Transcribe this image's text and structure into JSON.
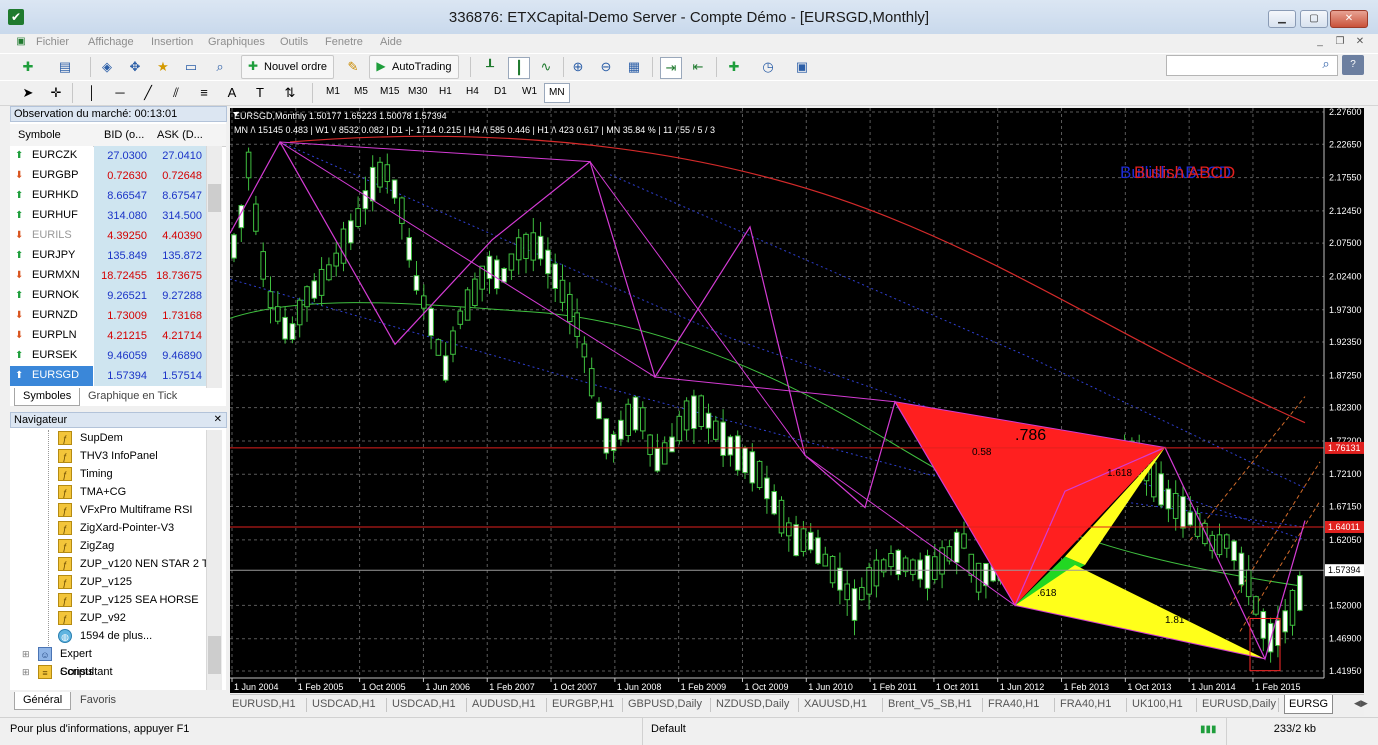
{
  "window": {
    "title": "336876: ETXCapital-Demo Server - Compte Démo - [EURSGD,Monthly]"
  },
  "menu": [
    "Fichier",
    "Affichage",
    "Insertion",
    "Graphiques",
    "Outils",
    "Fenetre",
    "Aide"
  ],
  "toolbar": {
    "new_order_label": "Nouvel ordre",
    "autotrading_label": "AutoTrading",
    "timeframes": [
      "M1",
      "M5",
      "M15",
      "M30",
      "H1",
      "H4",
      "D1",
      "W1",
      "MN"
    ],
    "active_timeframe": "MN"
  },
  "market_watch": {
    "title": "Observation du marché: 00:13:01",
    "col_symbol": "Symbole",
    "col_bid": "BID (o...",
    "col_ask": "ASK (D...",
    "rows": [
      {
        "symbol": "EURCZK",
        "dir": "up",
        "bid": "27.0300",
        "ask": "27.0410",
        "color": "blue"
      },
      {
        "symbol": "EURGBP",
        "dir": "down",
        "bid": "0.72630",
        "ask": "0.72648",
        "color": "red"
      },
      {
        "symbol": "EURHKD",
        "dir": "up",
        "bid": "8.66547",
        "ask": "8.67547",
        "color": "blue"
      },
      {
        "symbol": "EURHUF",
        "dir": "up",
        "bid": "314.080",
        "ask": "314.500",
        "color": "blue"
      },
      {
        "symbol": "EURILS",
        "dir": "down",
        "bid": "4.39250",
        "ask": "4.40390",
        "color": "red",
        "dim": true
      },
      {
        "symbol": "EURJPY",
        "dir": "up",
        "bid": "135.849",
        "ask": "135.872",
        "color": "blue"
      },
      {
        "symbol": "EURMXN",
        "dir": "down",
        "bid": "18.72455",
        "ask": "18.73675",
        "color": "red"
      },
      {
        "symbol": "EURNOK",
        "dir": "up",
        "bid": "9.26521",
        "ask": "9.27288",
        "color": "blue"
      },
      {
        "symbol": "EURNZD",
        "dir": "down",
        "bid": "1.73009",
        "ask": "1.73168",
        "color": "red"
      },
      {
        "symbol": "EURPLN",
        "dir": "down",
        "bid": "4.21215",
        "ask": "4.21714",
        "color": "red"
      },
      {
        "symbol": "EURSEK",
        "dir": "up",
        "bid": "9.46059",
        "ask": "9.46890",
        "color": "blue"
      },
      {
        "symbol": "EURSGD",
        "dir": "up",
        "bid": "1.57394",
        "ask": "1.57514",
        "color": "blue",
        "selected": true
      }
    ],
    "tabs": [
      "Symboles",
      "Graphique en Tick"
    ]
  },
  "navigator": {
    "title": "Navigateur",
    "items": [
      "SupDem",
      "THV3 InfoPanel",
      "Timing",
      "TMA+CG",
      "VFxPro Multiframe RSI",
      "ZigXard-Pointer-V3",
      "ZigZag",
      "ZUP_v120 NEN STAR 2 TR",
      "ZUP_v125",
      "ZUP_v125 SEA HORSE",
      "ZUP_v92",
      "1594 de plus..."
    ],
    "groups": [
      "Expert Consultant",
      "Scripts"
    ],
    "tabs": [
      "Général",
      "Favoris"
    ]
  },
  "chart": {
    "header": "EURSGD,Monthly  1.50177 1.65223 1.50078 1.57394",
    "info_line": "MN /\\ 15145   0.483  |  W1 \\/ 8532   0.082  |  D1 -|- 1714   0.215  |  H4 /\\ 585   0.446  |  H1 /\\ 423   0.617  |  MN  35.84 %  |  11 / 55 / 5 / 3",
    "pattern_label_blue": "Bullish AB=CD",
    "pattern_label_red": "Bullish ABCD",
    "fib_labels": [
      ".786",
      "0.58",
      "1.618",
      ".618",
      "1.81"
    ],
    "price_ticks": [
      "2.27600",
      "2.22650",
      "2.17550",
      "2.12450",
      "2.07500",
      "2.02400",
      "1.97300",
      "1.92350",
      "1.87250",
      "1.82300",
      "1.77200",
      "1.72100",
      "1.67150",
      "1.62050",
      "1.57394",
      "1.52000",
      "1.46900",
      "1.41950"
    ],
    "price_marks": [
      {
        "label": "1.76131",
        "color": "#e0201e"
      },
      {
        "label": "1.64011",
        "color": "#e0201e"
      },
      {
        "label": "1.57394",
        "color": "#ffffff"
      }
    ],
    "time_ticks": [
      "1 Jun 2004",
      "1 Feb 2005",
      "1 Oct 2005",
      "1 Jun 2006",
      "1 Feb 2007",
      "1 Oct 2007",
      "1 Jun 2008",
      "1 Feb 2009",
      "1 Oct 2009",
      "1 Jun 2010",
      "1 Feb 2011",
      "1 Oct 2011",
      "1 Jun 2012",
      "1 Feb 2013",
      "1 Oct 2013",
      "1 Jun 2014",
      "1 Feb 2015"
    ],
    "tabs": [
      "EURUSD,H1",
      "USDCAD,H1",
      "USDCAD,H1",
      "AUDUSD,H1",
      "EURGBP,H1",
      "GBPUSD,Daily",
      "NZDUSD,Daily",
      "XAUUSD,H1",
      "Brent_V5_SB,H1",
      "FRA40,H1",
      "FRA40,H1",
      "UK100,H1",
      "EURUSD,Daily",
      "EURSG"
    ],
    "active_tab": "EURSG"
  },
  "status": {
    "hint": "Pour plus d'informations, appuyer F1",
    "profile": "Default",
    "traffic": "233/2 kb"
  }
}
